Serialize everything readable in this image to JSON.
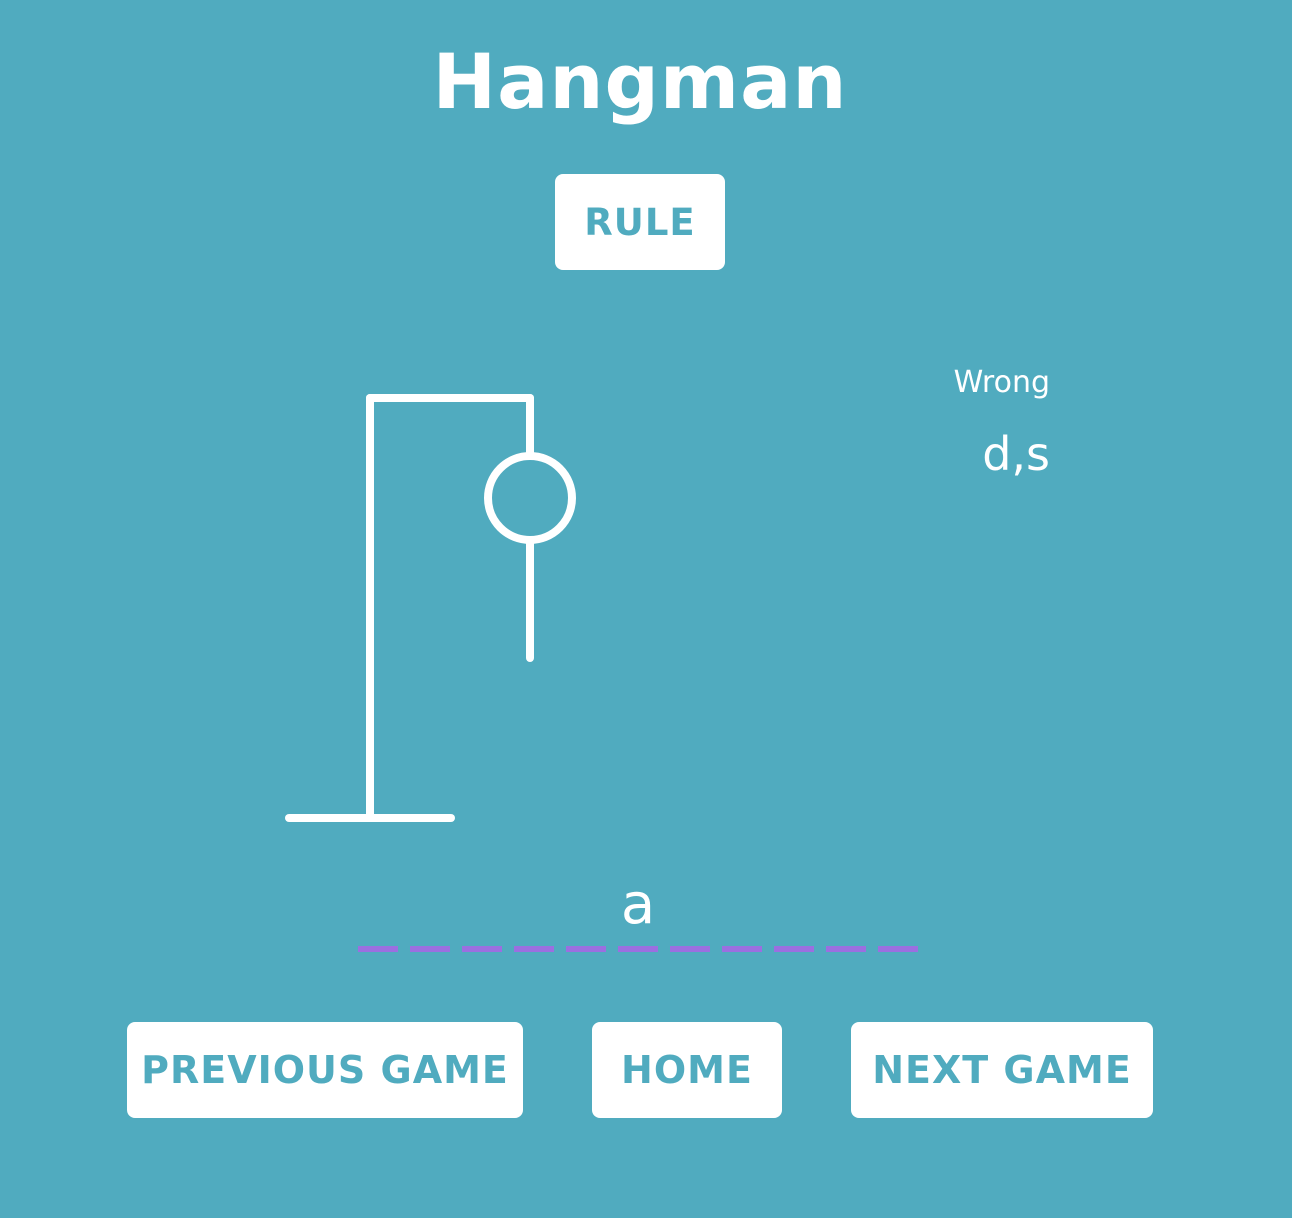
{
  "title": "Hangman",
  "buttons": {
    "rule": "RULE",
    "previous": "PREVIOUS GAME",
    "home": "HOME",
    "next": "NEXT GAME"
  },
  "wrong": {
    "label": "Wrong",
    "letters": "d,s"
  },
  "word": [
    "",
    "",
    "",
    "",
    "",
    "a",
    "",
    "",
    "",
    "",
    ""
  ],
  "hangman": {
    "parts_shown": [
      "head",
      "body"
    ]
  },
  "colors": {
    "background": "#50abbf",
    "foreground": "#ffffff",
    "dash": "#9b6fe0"
  }
}
